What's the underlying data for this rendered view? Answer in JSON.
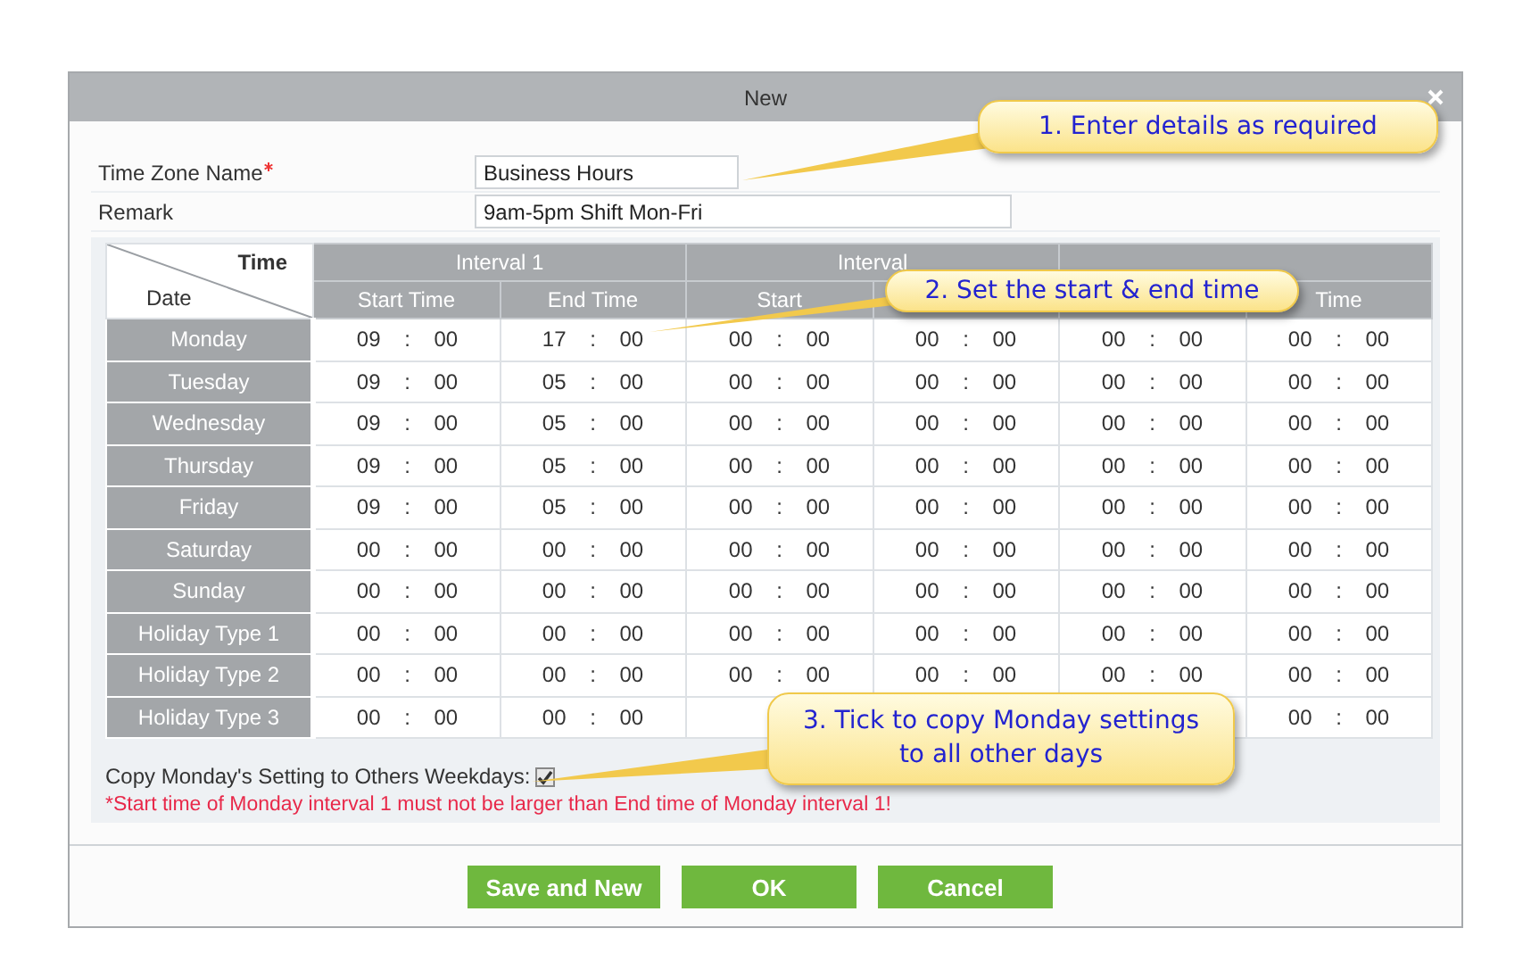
{
  "window": {
    "title": "New"
  },
  "form": [
    {
      "label": "Time Zone Name",
      "required": true,
      "value": "Business Hours"
    },
    {
      "label": "Remark",
      "required": false,
      "value": "9am-5pm Shift Mon-Fri"
    }
  ],
  "table": {
    "corner_top": "Time",
    "corner_bottom": "Date",
    "intervals": [
      {
        "label": "Interval 1",
        "start": "Start Time",
        "end": "End Time"
      },
      {
        "label": "Interval",
        "start": "Start"
      },
      {
        "end": "Time"
      }
    ],
    "rows": [
      {
        "day": "Monday",
        "cells": [
          {
            "value": "09 : 00"
          },
          {
            "value": "17 : 00"
          },
          {
            "value": "00 : 00"
          },
          {
            "value": "00 : 00"
          },
          {
            "value": "00 : 00"
          },
          {
            "value": "00 : 00"
          }
        ]
      },
      {
        "day": "Tuesday",
        "cells": [
          {
            "value": "09 : 00"
          },
          {
            "value": "05 : 00"
          },
          {
            "value": "00 : 00"
          },
          {
            "value": "00 : 00"
          },
          {
            "value": "00 : 00"
          },
          {
            "value": "00 : 00"
          }
        ]
      },
      {
        "day": "Wednesday",
        "cells": [
          {
            "value": "09 : 00"
          },
          {
            "value": "05 : 00"
          },
          {
            "value": "00 : 00"
          },
          {
            "value": "00 : 00"
          },
          {
            "value": "00 : 00"
          },
          {
            "value": "00 : 00"
          }
        ]
      },
      {
        "day": "Thursday",
        "cells": [
          {
            "value": "09 : 00"
          },
          {
            "value": "05 : 00"
          },
          {
            "value": "00 : 00"
          },
          {
            "value": "00 : 00"
          },
          {
            "value": "00 : 00"
          },
          {
            "value": "00 : 00"
          }
        ]
      },
      {
        "day": "Friday",
        "cells": [
          {
            "value": "09 : 00"
          },
          {
            "value": "05 : 00"
          },
          {
            "value": "00 : 00"
          },
          {
            "value": "00 : 00"
          },
          {
            "value": "00 : 00"
          },
          {
            "value": "00 : 00"
          }
        ]
      },
      {
        "day": "Saturday",
        "cells": [
          {
            "value": "00 : 00"
          },
          {
            "value": "00 : 00"
          },
          {
            "value": "00 : 00"
          },
          {
            "value": "00 : 00"
          },
          {
            "value": "00 : 00"
          },
          {
            "value": "00 : 00"
          }
        ]
      },
      {
        "day": "Sunday",
        "cells": [
          {
            "value": "00 : 00"
          },
          {
            "value": "00 : 00"
          },
          {
            "value": "00 : 00"
          },
          {
            "value": "00 : 00"
          },
          {
            "value": "00 : 00"
          },
          {
            "value": "00 : 00"
          }
        ]
      },
      {
        "day": "Holiday Type 1",
        "cells": [
          {
            "value": "00 : 00"
          },
          {
            "value": "00 : 00"
          },
          {
            "value": "00 : 00"
          },
          {
            "value": "00 : 00"
          },
          {
            "value": "00 : 00"
          },
          {
            "value": "00 : 00"
          }
        ]
      },
      {
        "day": "Holiday Type 2",
        "cells": [
          {
            "value": "00 : 00"
          },
          {
            "value": "00 : 00"
          },
          {
            "value": "00 : 00"
          },
          {
            "value": "00 : 00"
          },
          {
            "value": "00 : 00"
          },
          {
            "value": "00 : 00"
          }
        ]
      },
      {
        "day": "Holiday Type 3",
        "cells": [
          {
            "value": "00 : 00"
          },
          {
            "value": "00 : 00"
          },
          {},
          {},
          {},
          {
            "value": "00 : 00"
          }
        ]
      }
    ]
  },
  "copy_setting": {
    "label": "Copy Monday's Setting to Others Weekdays:",
    "checked": true
  },
  "error": "*Start time of Monday interval 1 must not be larger than End time of Monday interval 1!",
  "buttons": [
    "Save and New",
    "OK",
    "Cancel"
  ],
  "callouts": [
    "1. Enter details as required",
    "2. Set the start & end time",
    "3. Tick to copy Monday settings to all other days"
  ]
}
